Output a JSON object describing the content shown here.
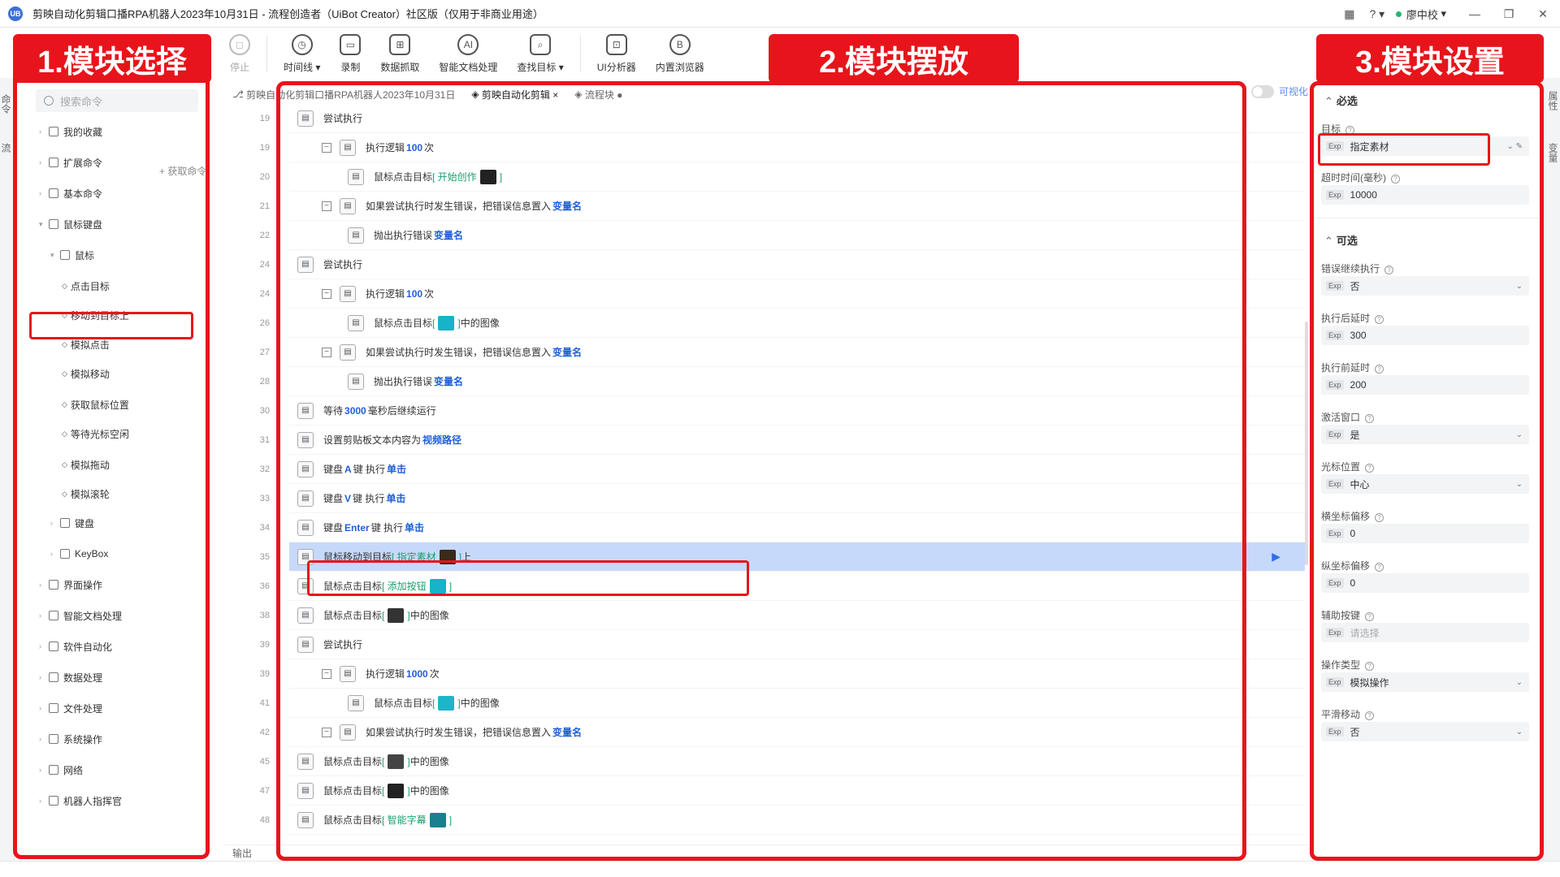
{
  "window": {
    "title": "剪映自动化剪辑口播RPA机器人2023年10月31日 - 流程创造者（UiBot Creator）社区版（仅用于非商业用途）",
    "logo_text": "UB",
    "user_name": "廖中校"
  },
  "toolbar": [
    {
      "label": "停止",
      "icon": "stop-icon",
      "glyph": "◻",
      "disabled": true
    },
    {
      "label": "时间线 ▾",
      "icon": "clock-icon",
      "glyph": "◷"
    },
    {
      "label": "录制",
      "icon": "record-icon",
      "glyph": "▭"
    },
    {
      "label": "数据抓取",
      "icon": "data-scrape-icon",
      "glyph": "⊞"
    },
    {
      "label": "智能文档处理",
      "icon": "ai-doc-icon",
      "glyph": "AI"
    },
    {
      "label": "查找目标 ▾",
      "icon": "find-target-icon",
      "glyph": "⌕"
    },
    {
      "label": "UI分析器",
      "icon": "ui-analyzer-icon",
      "glyph": "⊡"
    },
    {
      "label": "内置浏览器",
      "icon": "browser-icon",
      "glyph": "B"
    }
  ],
  "annotations": {
    "label1": "1.模块选择",
    "label2": "2.模块摆放",
    "label3": "3.模块设置"
  },
  "left_tabs": [
    "命令",
    "流"
  ],
  "left_panel": {
    "search_placeholder": "搜索命令",
    "get_cmd": "+ 获取命令",
    "items": [
      {
        "label": "我的收藏",
        "level": 0
      },
      {
        "label": "扩展命令",
        "level": 0
      },
      {
        "label": "基本命令",
        "level": 0
      },
      {
        "label": "鼠标键盘",
        "level": 0,
        "open": true
      },
      {
        "label": "鼠标",
        "level": 1,
        "open": true
      },
      {
        "label": "点击目标",
        "level": 2
      },
      {
        "label": "移动到目标上",
        "level": 2,
        "selected": true
      },
      {
        "label": "模拟点击",
        "level": 2
      },
      {
        "label": "模拟移动",
        "level": 2
      },
      {
        "label": "获取鼠标位置",
        "level": 2
      },
      {
        "label": "等待光标空闲",
        "level": 2
      },
      {
        "label": "模拟拖动",
        "level": 2
      },
      {
        "label": "模拟滚轮",
        "level": 2
      },
      {
        "label": "键盘",
        "level": 1
      },
      {
        "label": "KeyBox",
        "level": 1
      },
      {
        "label": "界面操作",
        "level": 0
      },
      {
        "label": "智能文档处理",
        "level": 0
      },
      {
        "label": "软件自动化",
        "level": 0
      },
      {
        "label": "数据处理",
        "level": 0
      },
      {
        "label": "文件处理",
        "level": 0
      },
      {
        "label": "系统操作",
        "level": 0
      },
      {
        "label": "网络",
        "level": 0
      },
      {
        "label": "机器人指挥官",
        "level": 0
      }
    ]
  },
  "center": {
    "tabs": [
      "剪映自动化剪辑口播RPA机器人2023年10月31日",
      "剪映自动化剪辑 ×",
      "流程块 ●"
    ],
    "toggle_label": "可视化",
    "output_label": "输出",
    "rows": [
      {
        "num": "19",
        "indent": 0,
        "icon": "try-icon",
        "parts": [
          {
            "t": "尝试执行"
          }
        ]
      },
      {
        "num": "19",
        "indent": 1,
        "expand": true,
        "icon": "loop-icon",
        "parts": [
          {
            "t": "执行逻辑 "
          },
          {
            "t": "100",
            "c": "blue"
          },
          {
            "t": " 次"
          }
        ]
      },
      {
        "num": "20",
        "indent": 2,
        "icon": "mouse-icon",
        "parts": [
          {
            "t": "鼠标点击目标 "
          },
          {
            "t": "[ 开始创作 ",
            "c": "green"
          },
          {
            "thumb": "#222"
          },
          {
            "t": " ]",
            "c": "green"
          }
        ]
      },
      {
        "num": "21",
        "indent": 1,
        "expand": true,
        "icon": "catch-icon",
        "parts": [
          {
            "t": "如果尝试执行时发生错误，把错误信息置入 "
          },
          {
            "t": "变量名",
            "c": "blue"
          }
        ]
      },
      {
        "num": "22",
        "indent": 2,
        "icon": "throw-icon",
        "parts": [
          {
            "t": "抛出执行错误 "
          },
          {
            "t": "变量名",
            "c": "blue"
          }
        ]
      },
      {
        "num": "24",
        "indent": 0,
        "icon": "try-icon",
        "parts": [
          {
            "t": "尝试执行"
          }
        ]
      },
      {
        "num": "24",
        "indent": 1,
        "expand": true,
        "icon": "loop-icon",
        "parts": [
          {
            "t": "执行逻辑 "
          },
          {
            "t": "100",
            "c": "blue"
          },
          {
            "t": " 次"
          }
        ]
      },
      {
        "num": "26",
        "indent": 2,
        "icon": "image-icon",
        "parts": [
          {
            "t": "鼠标点击目标 "
          },
          {
            "t": "[ ",
            "c": "green"
          },
          {
            "thumb": "#16b3c9"
          },
          {
            "t": " ]",
            "c": "green"
          },
          {
            "t": " 中的图像"
          }
        ]
      },
      {
        "num": "27",
        "indent": 1,
        "expand": true,
        "icon": "catch-icon",
        "parts": [
          {
            "t": "如果尝试执行时发生错误，把错误信息置入 "
          },
          {
            "t": "变量名",
            "c": "blue"
          }
        ]
      },
      {
        "num": "28",
        "indent": 2,
        "icon": "throw-icon",
        "parts": [
          {
            "t": "抛出执行错误 "
          },
          {
            "t": "变量名",
            "c": "blue"
          }
        ]
      },
      {
        "num": "30",
        "indent": 0,
        "icon": "wait-icon",
        "parts": [
          {
            "t": "等待 "
          },
          {
            "t": "3000",
            "c": "blue"
          },
          {
            "t": " 毫秒后继续运行"
          }
        ]
      },
      {
        "num": "31",
        "indent": 0,
        "icon": "clipboard-icon",
        "parts": [
          {
            "t": "设置剪贴板文本内容为 "
          },
          {
            "t": "视频路径",
            "c": "blue"
          }
        ]
      },
      {
        "num": "32",
        "indent": 0,
        "icon": "keyboard-icon",
        "parts": [
          {
            "t": "键盘 "
          },
          {
            "t": "A",
            "c": "blue"
          },
          {
            "t": " 键 执行 "
          },
          {
            "t": "单击",
            "c": "blue"
          }
        ]
      },
      {
        "num": "33",
        "indent": 0,
        "icon": "keyboard-icon",
        "parts": [
          {
            "t": "键盘 "
          },
          {
            "t": "V",
            "c": "blue"
          },
          {
            "t": " 键 执行 "
          },
          {
            "t": "单击",
            "c": "blue"
          }
        ]
      },
      {
        "num": "34",
        "indent": 0,
        "icon": "keyboard-icon",
        "parts": [
          {
            "t": "键盘 "
          },
          {
            "t": "Enter",
            "c": "blue"
          },
          {
            "t": " 键 执行 "
          },
          {
            "t": "单击",
            "c": "blue"
          }
        ]
      },
      {
        "num": "35",
        "indent": 0,
        "icon": "mouse-icon",
        "selected": true,
        "parts": [
          {
            "t": "鼠标移动到目标 "
          },
          {
            "t": "[ 指定素材 ",
            "c": "green"
          },
          {
            "thumb": "#3a2a1a"
          },
          {
            "t": " ]",
            "c": "green"
          },
          {
            "t": " 上"
          }
        ]
      },
      {
        "num": "36",
        "indent": 0,
        "icon": "mouse-icon",
        "parts": [
          {
            "t": "鼠标点击目标 "
          },
          {
            "t": "[ 添加按钮 ",
            "c": "green"
          },
          {
            "thumb": "#16b3c9"
          },
          {
            "t": " ]",
            "c": "green"
          }
        ]
      },
      {
        "num": "38",
        "indent": 0,
        "icon": "image-icon",
        "parts": [
          {
            "t": "鼠标点击目标 "
          },
          {
            "t": "[ ",
            "c": "green"
          },
          {
            "thumb": "#333"
          },
          {
            "t": " ]",
            "c": "green"
          },
          {
            "t": " 中的图像"
          }
        ]
      },
      {
        "num": "39",
        "indent": 0,
        "icon": "try-icon",
        "parts": [
          {
            "t": "尝试执行"
          }
        ]
      },
      {
        "num": "39",
        "indent": 1,
        "expand": true,
        "icon": "loop-icon",
        "parts": [
          {
            "t": "执行逻辑 "
          },
          {
            "t": "1000",
            "c": "blue"
          },
          {
            "t": " 次"
          }
        ]
      },
      {
        "num": "41",
        "indent": 2,
        "icon": "image-icon",
        "parts": [
          {
            "t": "鼠标点击目标 "
          },
          {
            "t": "[ ",
            "c": "green"
          },
          {
            "thumb": "#1fb5c8"
          },
          {
            "t": " ]",
            "c": "green"
          },
          {
            "t": " 中的图像"
          }
        ]
      },
      {
        "num": "42",
        "indent": 1,
        "expand": true,
        "icon": "catch-icon",
        "parts": [
          {
            "t": "如果尝试执行时发生错误，把错误信息置入 "
          },
          {
            "t": "变量名",
            "c": "blue"
          }
        ]
      },
      {
        "num": "45",
        "indent": 0,
        "icon": "image-icon",
        "parts": [
          {
            "t": "鼠标点击目标 "
          },
          {
            "t": "[ ",
            "c": "green"
          },
          {
            "thumb": "#444"
          },
          {
            "t": " ]",
            "c": "green"
          },
          {
            "t": " 中的图像"
          }
        ]
      },
      {
        "num": "47",
        "indent": 0,
        "icon": "image-icon",
        "parts": [
          {
            "t": "鼠标点击目标 "
          },
          {
            "t": "[ ",
            "c": "green"
          },
          {
            "thumb": "#222"
          },
          {
            "t": " ]",
            "c": "green"
          },
          {
            "t": " 中的图像"
          }
        ]
      },
      {
        "num": "48",
        "indent": 0,
        "icon": "mouse-icon",
        "parts": [
          {
            "t": "鼠标点击目标 "
          },
          {
            "t": "[ 智能字幕 ",
            "c": "green"
          },
          {
            "thumb": "#1a7f8f"
          },
          {
            "t": " ]",
            "c": "green"
          }
        ]
      }
    ]
  },
  "right_tabs": [
    "属性",
    "变量"
  ],
  "right_panel": {
    "required_title": "必选",
    "optional_title": "可选",
    "exp_badge": "Exp",
    "required": [
      {
        "label": "目标",
        "value": "指定素材",
        "edit": true
      },
      {
        "label": "超时时间(毫秒)",
        "value": "10000"
      }
    ],
    "optional": [
      {
        "label": "错误继续执行",
        "value": "否",
        "dropdown": true
      },
      {
        "label": "执行后延时",
        "value": "300"
      },
      {
        "label": "执行前延时",
        "value": "200"
      },
      {
        "label": "激活窗口",
        "value": "是",
        "dropdown": true
      },
      {
        "label": "光标位置",
        "value": "中心",
        "dropdown": true
      },
      {
        "label": "横坐标偏移",
        "value": "0"
      },
      {
        "label": "纵坐标偏移",
        "value": "0"
      },
      {
        "label": "辅助按键",
        "value": "",
        "placeholder": "请选择"
      },
      {
        "label": "操作类型",
        "value": "模拟操作",
        "dropdown": true
      },
      {
        "label": "平滑移动",
        "value": "否",
        "dropdown": true
      }
    ]
  },
  "colors": {
    "accent_red": "#e8141b",
    "selected_row": "#c7d9fb",
    "token_blue": "#1f5fd6",
    "token_green": "#1aa06d"
  }
}
